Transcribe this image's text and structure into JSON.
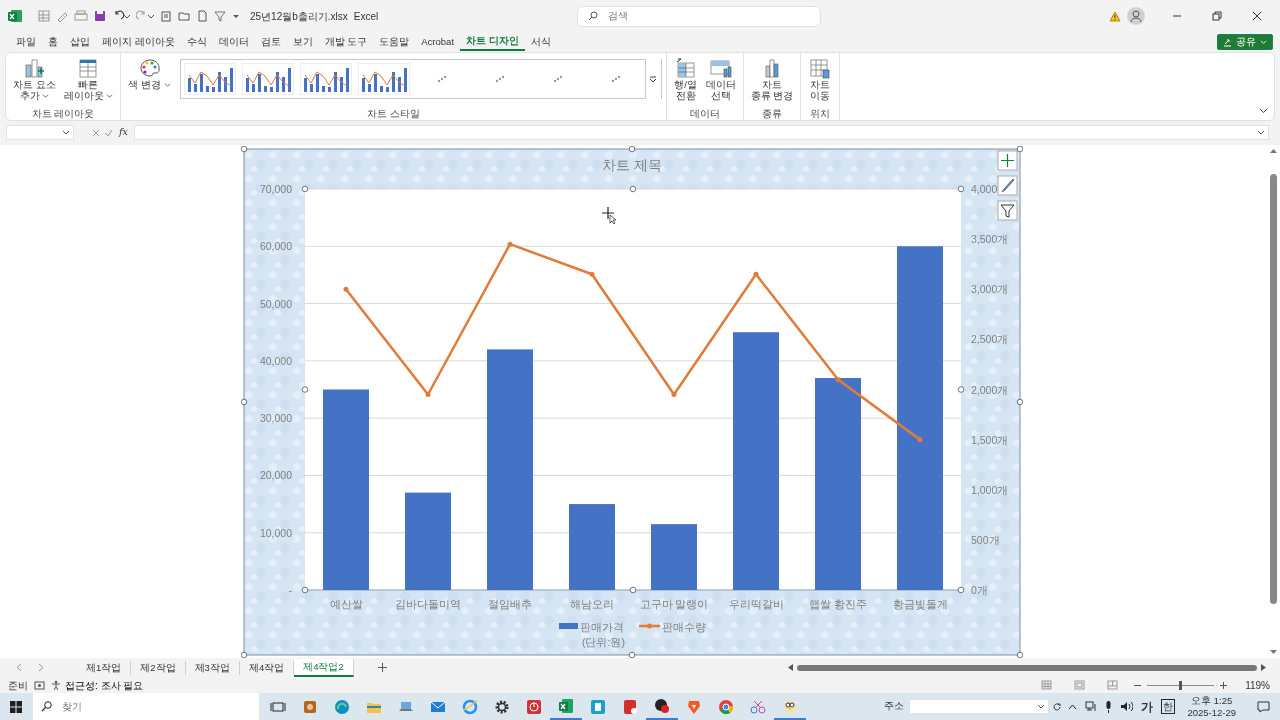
{
  "title_bar": {
    "file_name": "25년12월b출리기.xlsx",
    "app_name": "Excel",
    "search": {
      "placeholder": "검색"
    }
  },
  "ribbon_tabs": [
    {
      "label": "파일",
      "selected": false
    },
    {
      "label": "홈",
      "selected": false
    },
    {
      "label": "삽입",
      "selected": false
    },
    {
      "label": "페이지 레이아웃",
      "selected": false
    },
    {
      "label": "수식",
      "selected": false
    },
    {
      "label": "데이터",
      "selected": false
    },
    {
      "label": "검토",
      "selected": false
    },
    {
      "label": "보기",
      "selected": false
    },
    {
      "label": "개발 도구",
      "selected": false
    },
    {
      "label": "도움말",
      "selected": false
    },
    {
      "label": "Acrobat",
      "selected": false
    },
    {
      "label": "차트 디자인",
      "selected": true
    },
    {
      "label": "서식",
      "selected": false
    }
  ],
  "share_button": {
    "label": "공유"
  },
  "ribbon_groups": [
    {
      "label": "차트 레이아웃",
      "buttons": [
        {
          "kind": "add-element",
          "label": "차트 요소\n추가",
          "dropdown": true
        },
        {
          "kind": "quick-layout",
          "label": "빠른\n레이아웃",
          "dropdown": true
        }
      ]
    },
    {
      "label": "차트 스타일",
      "buttons": [
        {
          "kind": "palette",
          "label": "색 변경",
          "dropdown": true
        }
      ],
      "gallery": [
        {
          "kind": "preview"
        },
        {
          "kind": "preview"
        },
        {
          "kind": "preview"
        },
        {
          "kind": "preview"
        },
        {
          "kind": "loading"
        },
        {
          "kind": "loading"
        },
        {
          "kind": "loading"
        },
        {
          "kind": "loading"
        }
      ]
    },
    {
      "label": "데이터",
      "buttons": [
        {
          "kind": "switch",
          "label": "행/열\n전환",
          "dropdown": false
        },
        {
          "kind": "select-data",
          "label": "데이터\n선택",
          "dropdown": false
        }
      ]
    },
    {
      "label": "종류",
      "buttons": [
        {
          "kind": "change-type",
          "label": "차트\n종류 변경",
          "dropdown": false
        }
      ]
    },
    {
      "label": "위치",
      "buttons": [
        {
          "kind": "move",
          "label": "차트\n이동",
          "dropdown": false
        }
      ]
    }
  ],
  "formula_bar": {
    "fx_label": "fx"
  },
  "chart": {
    "title": "차트 제목",
    "legend_note": "(단위:원)",
    "chart_data": {
      "type": "bar",
      "categories": [
        "예산쌀",
        "김바다돌미역",
        "절임배추",
        "해남오리",
        "고구마 말랭이",
        "우리떡갈비",
        "햅쌀 황진주",
        "황금빛돌게"
      ],
      "series": [
        {
          "name": "판매가격",
          "color": "#4472c4",
          "values": [
            35000,
            17000,
            42000,
            15000,
            11500,
            45000,
            37000,
            60000
          ]
        },
        {
          "name": "판매수량",
          "type": "line",
          "axis": "y2",
          "color": "#e07b39",
          "values": [
            3000,
            1950,
            3450,
            3150,
            1950,
            3150,
            2100,
            1500
          ]
        }
      ],
      "grid": true,
      "legend": true,
      "ylim": [
        0,
        70000
      ],
      "yticks": [
        {
          "value": 0,
          "label": "-"
        },
        {
          "value": 10000,
          "label": "10,000"
        },
        {
          "value": 20000,
          "label": "20,000"
        },
        {
          "value": 30000,
          "label": "30,000"
        },
        {
          "value": 40000,
          "label": "40,000"
        },
        {
          "value": 50000,
          "label": "50,000"
        },
        {
          "value": 60000,
          "label": "60,000"
        },
        {
          "value": 70000,
          "label": "70,000"
        }
      ],
      "y2lim": [
        0,
        4000
      ],
      "y2ticks": [
        {
          "value": 0,
          "label": "0개"
        },
        {
          "value": 500,
          "label": "500개"
        },
        {
          "value": 1000,
          "label": "1,000개"
        },
        {
          "value": 1500,
          "label": "1,500개"
        },
        {
          "value": 2000,
          "label": "2,000개"
        },
        {
          "value": 2500,
          "label": "2,500개"
        },
        {
          "value": 3000,
          "label": "3,000개"
        },
        {
          "value": 3500,
          "label": "3,500개"
        },
        {
          "value": 4000,
          "label": "4,000"
        }
      ]
    }
  },
  "sheet_tabs": [
    {
      "label": "제1작업",
      "selected": false
    },
    {
      "label": "제2작업",
      "selected": false
    },
    {
      "label": "제3작업",
      "selected": false
    },
    {
      "label": "제4작업",
      "selected": false
    },
    {
      "label": "제4작업2",
      "selected": true
    }
  ],
  "status_bar": {
    "ready": "준비",
    "accessibility": "접근성: 조사 필요",
    "zoom": {
      "level": 0.5,
      "reading": "119%"
    }
  },
  "taskbar": {
    "search": {
      "placeholder": "찾기"
    },
    "apps": [
      {
        "kind": "task-view",
        "running": false
      },
      {
        "kind": "photo",
        "running": false
      },
      {
        "kind": "swirl",
        "running": false
      },
      {
        "kind": "folder",
        "running": false
      },
      {
        "kind": "laptop",
        "running": false
      },
      {
        "kind": "mail",
        "running": false
      },
      {
        "kind": "globe-e",
        "running": false
      },
      {
        "kind": "gear",
        "running": false
      },
      {
        "kind": "power",
        "running": false
      },
      {
        "kind": "sheet",
        "running": true
      },
      {
        "kind": "teal-tile",
        "running": false
      },
      {
        "kind": "pdf",
        "running": false
      },
      {
        "kind": "dots",
        "running": true
      },
      {
        "kind": "shield",
        "running": false
      },
      {
        "kind": "ring",
        "running": false
      },
      {
        "kind": "scissors",
        "running": false
      },
      {
        "kind": "owl",
        "running": true
      }
    ],
    "address_label": "주소",
    "ime_mode": "가",
    "ime_lang": "한",
    "time": "오후 1:25",
    "date": "2025-12-29"
  }
}
